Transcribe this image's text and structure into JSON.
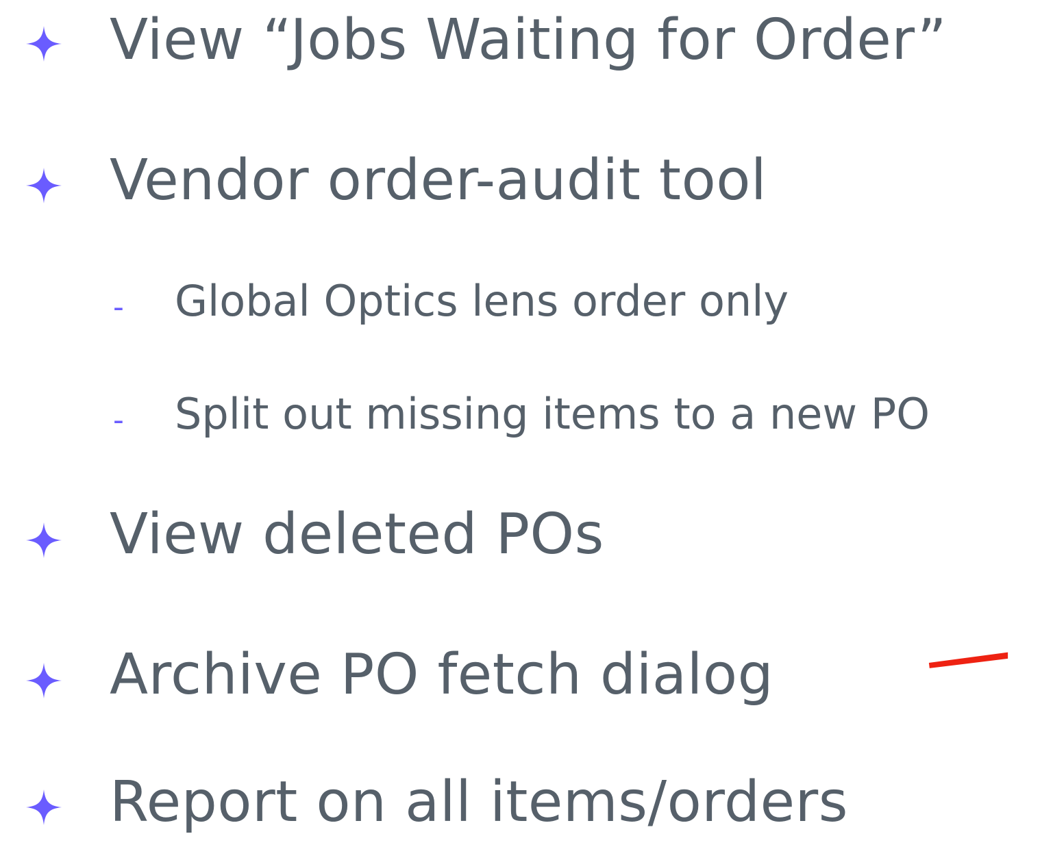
{
  "colors": {
    "text": "#56606a",
    "bullet": "#6a5cff",
    "dash": "#6a5cff",
    "annotation": "#ee2212"
  },
  "items": [
    {
      "text": "View “Jobs Waiting for Order”"
    },
    {
      "text": "Vendor order-audit tool"
    },
    {
      "text": "View deleted POs"
    },
    {
      "text": "Archive PO fetch dialog"
    },
    {
      "text": "Report on all items/orders"
    }
  ],
  "subitems": [
    {
      "dash": "-",
      "text": "Global Optics lens order only"
    },
    {
      "dash": "-",
      "text": "Split out missing items to a new PO"
    }
  ],
  "icons": {
    "bullet": "four-point-star-icon"
  }
}
